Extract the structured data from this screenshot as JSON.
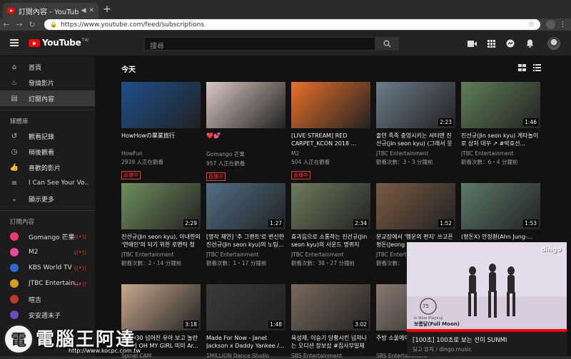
{
  "browser": {
    "tab_title": "訂閱內容 - YouTube",
    "url": "https://www.youtube.com/feed/subscriptions"
  },
  "header": {
    "logo_text": "YouTube",
    "logo_region": "TW",
    "search_placeholder": "搜尋"
  },
  "sidebar": {
    "main_items": [
      {
        "label": "首頁",
        "icon": "home-icon"
      },
      {
        "label": "發燒影片",
        "icon": "flame-icon"
      },
      {
        "label": "訂閱內容",
        "icon": "subscriptions-icon",
        "active": true
      }
    ],
    "library_heading": "媒體庫",
    "library_items": [
      {
        "label": "觀看記錄",
        "icon": "history-icon"
      },
      {
        "label": "稍後觀看",
        "icon": "clock-icon"
      },
      {
        "label": "喜歡的影片",
        "icon": "thumbs-up-icon"
      },
      {
        "label": "I Can See Your Vo...",
        "icon": "playlist-icon"
      },
      {
        "label": "顯示更多",
        "icon": "chevron-down-icon"
      }
    ],
    "subs_heading": "訂閱內容",
    "subscriptions": [
      {
        "label": "Gomango 芒果",
        "color": "#e83b6a",
        "live": true
      },
      {
        "label": "M2",
        "color": "#e64aa0",
        "live": true
      },
      {
        "label": "KBS World TV",
        "color": "#2a6ad8",
        "live": true
      },
      {
        "label": "JTBC Entertain...",
        "color": "#d4a01c",
        "live": true
      },
      {
        "label": "暄吉",
        "color": "#c0392b",
        "live": false
      },
      {
        "label": "安安週末子",
        "color": "#6d4cc2",
        "live": false
      }
    ]
  },
  "main": {
    "section_title": "今天",
    "rows": [
      [
        {
          "title": "HowHowの畢業旅行",
          "channel": "HowFun",
          "meta": "2939 人正在觀看",
          "live": "直播中",
          "duration": "",
          "bg": "#1e4f8c"
        },
        {
          "title": "❤️💕",
          "channel": "Gomango 芒果",
          "meta": "957 人正在觀看",
          "live": "直播中",
          "duration": "",
          "bg": "#d9c7c0"
        },
        {
          "title": "[LIVE STREAM] RED CARPET_KCON 2018 ...",
          "channel": "M2",
          "meta": "504 人正在觀看",
          "live": "直播中",
          "duration": "",
          "bg": "#e86f2a"
        },
        {
          "title": "출연 족족 충영시키는 셔터맨 진선규(Jin seon kyu) (그래서 뭇든...",
          "channel": "JTBC Entertainment",
          "meta": "觀看次數：3・3 分鐘前",
          "live": "",
          "duration": "2:23",
          "bg": "#6a7d8a"
        },
        {
          "title": "진선규(Jin seon kyu) 게타놀이로 상처 대꾸 ↗ #박호선...",
          "channel": "JTBC Entertainment",
          "meta": "觀看次數：6・4 分鐘前",
          "live": "",
          "duration": "1:46",
          "bg": "#5f7f56"
        }
      ],
      [
        {
          "title": "진선규(Jin seon kyu), 아내한의 '연애인'의 되기 위한 로맨틱 청춘...",
          "channel": "JTBC Entertainment",
          "meta": "觀看次數：2・14 分鐘前",
          "live": "",
          "duration": "2:29",
          "bg": "#6f8f5e"
        },
        {
          "title": "[명작 재연] '추 그랜트'로 변신한 진선규(Jin seon kyu)의 노팅...",
          "channel": "JTBC Entertainment",
          "meta": "觀看次數：1・17 分鐘前",
          "live": "",
          "duration": "1:27",
          "bg": "#4f6f86"
        },
        {
          "title": "효과음으로 소통하는 진선규(Jin seon kyu)의 사운드 명퀴지 \"피...",
          "channel": "JTBC Entertainment",
          "meta": "觀看次數：38・27 分鐘前",
          "live": "",
          "duration": "2:34",
          "bg": "#6d7c5c"
        },
        {
          "title": "분교장에서 '행운의 편지' 쓰고픈 형돈(Jeong H...",
          "channel": "JTBC Entertainment",
          "meta": "觀看次數：",
          "live": "",
          "duration": "1:52",
          "bg": "#7a5a42"
        },
        {
          "title": "(형돈X) 안정환(Ahn Jung-...",
          "channel": "JTBC Entertainment",
          "meta": "觀看次數：",
          "live": "",
          "duration": "1:53",
          "bg": "#5c7a6a"
        }
      ],
      [
        {
          "title": "180930 넘어진 유아 보고 놀란 우리의 OH MY GIRL 미미 Ar...",
          "channel": "Spinel CAM",
          "meta": "",
          "live": "",
          "duration": "3:18",
          "bg": "#c9a98e"
        },
        {
          "title": "Made For Now - Janet Jackson x Daddy Yankee /...",
          "channel": "1MILLION Dance Studio",
          "meta": "",
          "live": "",
          "duration": "1:48",
          "bg": "#3a3a3a"
        },
        {
          "title": "육성재, 이승기 당황시킨 넘쳐나는 오디션 장보샀 #집사부일체 ...",
          "channel": "SBS Entertainment",
          "meta": "",
          "live": "",
          "duration": "3:02",
          "bg": "#7a6a5a"
        },
        {
          "title": "주방 소울에이 꽃피운 성립성...",
          "channel": "SBS Entertainment",
          "meta": "",
          "live": "",
          "duration": "",
          "bg": "#8a7a70"
        }
      ]
    ]
  },
  "miniplayer": {
    "title": "[100초] 100초로 보는 선미 SUNMI",
    "subtitle": "딩고 뮤직 / dingo music",
    "logo": "dingo",
    "overlay_song": "보름달(Full Moon)",
    "overlay_label": "Is Now Playing",
    "overlay_count": "75"
  },
  "watermark": {
    "glyph": "電",
    "text": "電腦王阿達",
    "url": "http://www.kocpc.com.tw"
  }
}
